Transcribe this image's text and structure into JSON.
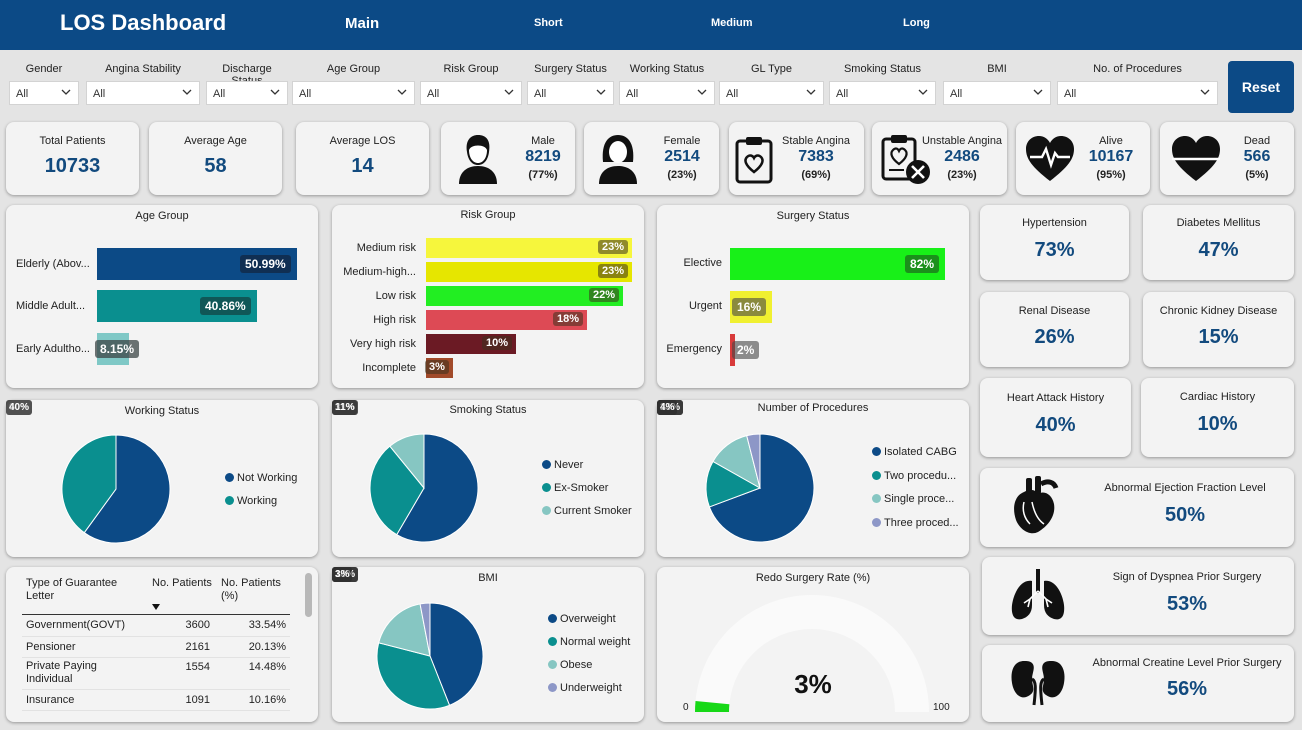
{
  "header": {
    "title": "LOS Dashboard",
    "tabs": [
      "Main",
      "Short",
      "Medium",
      "Long"
    ]
  },
  "filters": [
    {
      "label": "Gender",
      "value": "All"
    },
    {
      "label": "Angina Stability",
      "value": "All"
    },
    {
      "label": "Discharge Status",
      "value": "All"
    },
    {
      "label": "Age Group",
      "value": "All"
    },
    {
      "label": "Risk Group",
      "value": "All"
    },
    {
      "label": "Surgery Status",
      "value": "All"
    },
    {
      "label": "Working Status",
      "value": "All"
    },
    {
      "label": "GL Type",
      "value": "All"
    },
    {
      "label": "Smoking Status",
      "value": "All"
    },
    {
      "label": "BMI",
      "value": "All"
    },
    {
      "label": "No. of Procedures",
      "value": "All"
    }
  ],
  "reset_label": "Reset",
  "kpis": {
    "total": {
      "label": "Total Patients",
      "value": "10733"
    },
    "age": {
      "label": "Average Age",
      "value": "58"
    },
    "los": {
      "label": "Average LOS",
      "value": "14"
    },
    "male": {
      "label": "Male",
      "value": "8219",
      "pct": "(77%)",
      "icon": "male-icon"
    },
    "female": {
      "label": "Female",
      "value": "2514",
      "pct": "(23%)",
      "icon": "female-icon"
    },
    "stable": {
      "label": "Stable Angina",
      "value": "7383",
      "pct": "(69%)",
      "icon": "clipboard-heart-icon"
    },
    "unstable": {
      "label": "Unstable Angina",
      "value": "2486",
      "pct": "(23%)",
      "icon": "clipboard-heart-x-icon"
    },
    "alive": {
      "label": "Alive",
      "value": "10167",
      "pct": "(95%)",
      "icon": "heartbeat-icon"
    },
    "dead": {
      "label": "Dead",
      "value": "566",
      "pct": "(5%)",
      "icon": "heart-flatline-icon"
    }
  },
  "age_group": {
    "title": "Age Group",
    "bars": [
      {
        "label": "Elderly (Abov...",
        "pct": "50.99%",
        "value": 50.99,
        "color": "#0c4a86"
      },
      {
        "label": "Middle Adult...",
        "pct": "40.86%",
        "value": 40.86,
        "color": "#0a8f8f"
      },
      {
        "label": "Early Adultho...",
        "pct": "8.15%",
        "value": 8.15,
        "color": "#7fc8c6"
      }
    ]
  },
  "risk_group": {
    "title": "Risk Group",
    "bars": [
      {
        "label": "Medium risk",
        "pct": "23%",
        "value": 23,
        "color": "#f6f63c"
      },
      {
        "label": "Medium-high...",
        "pct": "23%",
        "value": 23,
        "color": "#e6e600"
      },
      {
        "label": "Low risk",
        "pct": "22%",
        "value": 22,
        "color": "#22ee22"
      },
      {
        "label": "High risk",
        "pct": "18%",
        "value": 18,
        "color": "#dd4a55"
      },
      {
        "label": "Very high risk",
        "pct": "10%",
        "value": 10,
        "color": "#6b1a24"
      },
      {
        "label": "Incomplete",
        "pct": "3%",
        "value": 3,
        "color": "#a14a2a"
      }
    ]
  },
  "surgery_status": {
    "title": "Surgery Status",
    "bars": [
      {
        "label": "Elective",
        "pct": "82%",
        "value": 82,
        "color": "#18f018"
      },
      {
        "label": "Urgent",
        "pct": "16%",
        "value": 16,
        "color": "#f0f030"
      },
      {
        "label": "Emergency",
        "pct": "2%",
        "value": 2,
        "color": "#d83a3a"
      }
    ]
  },
  "conditions": [
    {
      "label": "Hypertension",
      "value": "73%"
    },
    {
      "label": "Diabetes Mellitus",
      "value": "47%"
    },
    {
      "label": "Renal Disease",
      "value": "26%"
    },
    {
      "label": "Chronic Kidney Disease",
      "value": "15%"
    },
    {
      "label": "Heart Attack History",
      "value": "40%"
    },
    {
      "label": "Cardiac History",
      "value": "10%"
    }
  ],
  "wide_cards": [
    {
      "label": "Abnormal Ejection Fraction Level",
      "value": "50%",
      "icon": "heart-anatomy-icon"
    },
    {
      "label": "Sign of Dyspnea Prior Surgery",
      "value": "53%",
      "icon": "lungs-icon"
    },
    {
      "label": "Abnormal Creatine Level Prior Surgery",
      "value": "56%",
      "icon": "kidneys-icon"
    }
  ],
  "working_status": {
    "title": "Working Status",
    "slices": [
      {
        "name": "Not Working",
        "value": 60,
        "label": "60%",
        "color": "#0c4a86"
      },
      {
        "name": "Working",
        "value": 40,
        "label": "40%",
        "color": "#0a8f8f"
      }
    ]
  },
  "smoking_status": {
    "title": "Smoking Status",
    "slices": [
      {
        "name": "Never",
        "value": 59,
        "label": "59%",
        "color": "#0c4a86"
      },
      {
        "name": "Ex-Smoker",
        "value": 31,
        "label": "31%",
        "color": "#0a8f8f"
      },
      {
        "name": "Current Smoker",
        "value": 11,
        "label": "11%",
        "color": "#86c6c2"
      }
    ]
  },
  "procedures": {
    "title": "Number of Procedures",
    "slices": [
      {
        "name": "Isolated CABG",
        "value": 70,
        "label": "70%",
        "color": "#0c4a86"
      },
      {
        "name": "Two procedu...",
        "value": 14,
        "label": "14%",
        "color": "#0a8f8f"
      },
      {
        "name": "Single proce...",
        "value": 13,
        "label": "13%",
        "color": "#86c6c2"
      },
      {
        "name": "Three proced...",
        "value": 4,
        "label": "4%",
        "color": "#8d97c7"
      }
    ]
  },
  "bmi": {
    "title": "BMI",
    "slices": [
      {
        "name": "Overweight",
        "value": 44,
        "label": "44%",
        "color": "#0c4a86"
      },
      {
        "name": "Normal weight",
        "value": 35,
        "label": "35%",
        "color": "#0a8f8f"
      },
      {
        "name": "Obese",
        "value": 18,
        "label": "18%",
        "color": "#86c6c2"
      },
      {
        "name": "Underweight",
        "value": 3,
        "label": "3%",
        "color": "#8d97c7"
      }
    ]
  },
  "gl_table": {
    "headers": [
      "Type of Guarantee Letter",
      "No. Patients",
      "No. Patients (%)"
    ],
    "rows": [
      [
        "Government(GOVT)",
        "3600",
        "33.54%"
      ],
      [
        "Pensioner",
        "2161",
        "20.13%"
      ],
      [
        "Private Paying Individual",
        "1554",
        "14.48%"
      ],
      [
        "Insurance",
        "1091",
        "10.16%"
      ]
    ]
  },
  "redo": {
    "title": "Redo Surgery Rate (%)",
    "value": "3%",
    "min": "0",
    "max": "100",
    "rate": 3
  },
  "chart_data": [
    {
      "type": "bar",
      "title": "Age Group",
      "categories": [
        "Elderly (Abov...",
        "Middle Adult...",
        "Early Adultho..."
      ],
      "values": [
        50.99,
        40.86,
        8.15
      ]
    },
    {
      "type": "bar",
      "title": "Risk Group",
      "categories": [
        "Medium risk",
        "Medium-high...",
        "Low risk",
        "High risk",
        "Very high risk",
        "Incomplete"
      ],
      "values": [
        23,
        23,
        22,
        18,
        10,
        3
      ]
    },
    {
      "type": "bar",
      "title": "Surgery Status",
      "categories": [
        "Elective",
        "Urgent",
        "Emergency"
      ],
      "values": [
        82,
        16,
        2
      ]
    },
    {
      "type": "pie",
      "title": "Working Status",
      "categories": [
        "Not Working",
        "Working"
      ],
      "values": [
        60,
        40
      ]
    },
    {
      "type": "pie",
      "title": "Smoking Status",
      "categories": [
        "Never",
        "Ex-Smoker",
        "Current Smoker"
      ],
      "values": [
        59,
        31,
        11
      ]
    },
    {
      "type": "pie",
      "title": "Number of Procedures",
      "categories": [
        "Isolated CABG",
        "Two procedu...",
        "Single proce...",
        "Three proced..."
      ],
      "values": [
        70,
        14,
        13,
        4
      ]
    },
    {
      "type": "pie",
      "title": "BMI",
      "categories": [
        "Overweight",
        "Normal weight",
        "Obese",
        "Underweight"
      ],
      "values": [
        44,
        35,
        18,
        3
      ]
    }
  ]
}
